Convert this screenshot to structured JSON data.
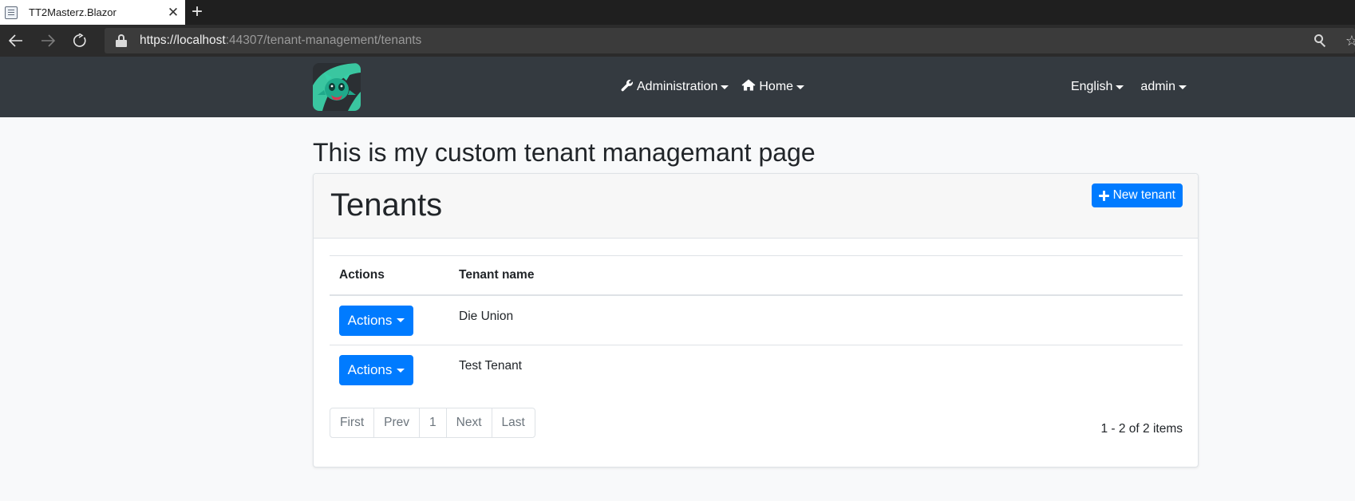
{
  "browser": {
    "tab_title": "TT2Masterz.Blazor",
    "tab_close": "✕",
    "new_tab": "+",
    "url_scheme": "https://",
    "url_host": "localhost",
    "url_rest": ":44307/tenant-management/tenants",
    "icons": [
      "back-icon",
      "forward-icon",
      "refresh-icon",
      "lock-icon",
      "key-icon",
      "star-icon"
    ]
  },
  "navbar": {
    "administration_label": "Administration",
    "home_label": "Home",
    "language_label": "English",
    "user_label": "admin"
  },
  "page": {
    "heading": "This is my custom tenant managemant page"
  },
  "card": {
    "title": "Tenants",
    "new_button_label": "New tenant"
  },
  "table": {
    "columns": [
      "Actions",
      "Tenant name"
    ],
    "rows": [
      {
        "action_label": "Actions",
        "name": "Die Union"
      },
      {
        "action_label": "Actions",
        "name": "Test Tenant"
      }
    ]
  },
  "pagination": {
    "first": "First",
    "prev": "Prev",
    "current": "1",
    "next": "Next",
    "last": "Last",
    "summary": "1 - 2 of 2 items"
  },
  "colors": {
    "navbar_bg": "#343a40",
    "primary": "#007bff",
    "page_bg": "#f8f9fa"
  }
}
